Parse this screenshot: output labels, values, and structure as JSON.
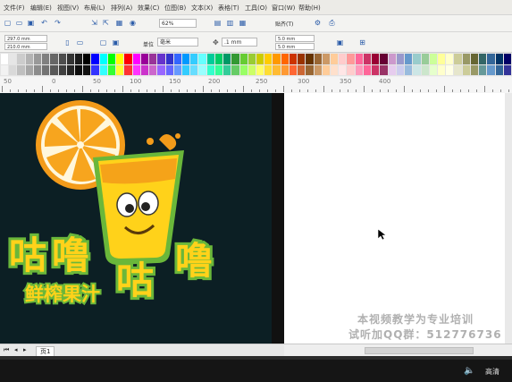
{
  "menu": {
    "items": [
      "文件(F)",
      "编辑(E)",
      "视图(V)",
      "布局(L)",
      "排列(A)",
      "效果(C)",
      "位图(B)",
      "文本(X)",
      "表格(T)",
      "工具(O)",
      "窗口(W)",
      "帮助(H)"
    ]
  },
  "toolbar": {
    "zoom_value": "62%",
    "snap_label": "贴齐(T)"
  },
  "propbar": {
    "width_value": "297.0 mm",
    "height_value": "210.0 mm",
    "units_label": "单位",
    "units_value": "毫米",
    "nudge_value": ".1 mm",
    "dup_x_value": "5.0 mm",
    "dup_y_value": "5.0 mm"
  },
  "ruler": {
    "labels": [
      "50",
      "0",
      "50",
      "100",
      "150",
      "200",
      "250",
      "300",
      "350",
      "400"
    ]
  },
  "artwork": {
    "title_top": "咕噜咕噜",
    "subtitle": "鲜榨果汁",
    "colors": {
      "orange": "#f39b1a",
      "green": "#6ab73a",
      "dark_bg": "#0c1f24",
      "yellow": "#ffd21a"
    }
  },
  "pages": {
    "current_tab": "页1"
  },
  "watermark": {
    "line1": "本视频教学为专业培训",
    "line2": "试听加QQ群：512776736"
  },
  "player": {
    "quality_label": "高清"
  }
}
